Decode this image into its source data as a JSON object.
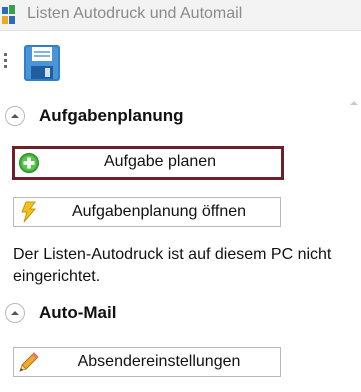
{
  "window": {
    "title": "Listen Autodruck und Automail"
  },
  "icons": {
    "app": "app-grid-icon",
    "save": "floppy-disk-icon",
    "add": "green-plus-icon",
    "lightning": "lightning-icon",
    "pencil": "pencil-icon",
    "collapse": "chevron-up-icon",
    "scroll_up": "scroll-up-arrow-icon"
  },
  "sections": [
    {
      "title": "Aufgabenplanung",
      "buttons": [
        {
          "label": "Aufgabe planen",
          "icon": "green-plus-icon",
          "focused": true
        },
        {
          "label": "Aufgabenplanung öffnen",
          "icon": "lightning-icon",
          "focused": false
        }
      ],
      "info": "Der Listen-Autodruck ist auf diesem PC nicht eingerichtet."
    },
    {
      "title": "Auto-Mail",
      "buttons": [
        {
          "label": "Absendereinstellungen",
          "icon": "pencil-icon",
          "focused": false
        }
      ]
    }
  ],
  "colors": {
    "focus_border": "#6e1f2c",
    "title_text": "#8a8a8a",
    "floppy_blue": "#2f7fc9",
    "plus_green": "#3eae34",
    "lightning_yellow": "#f2c21b"
  }
}
